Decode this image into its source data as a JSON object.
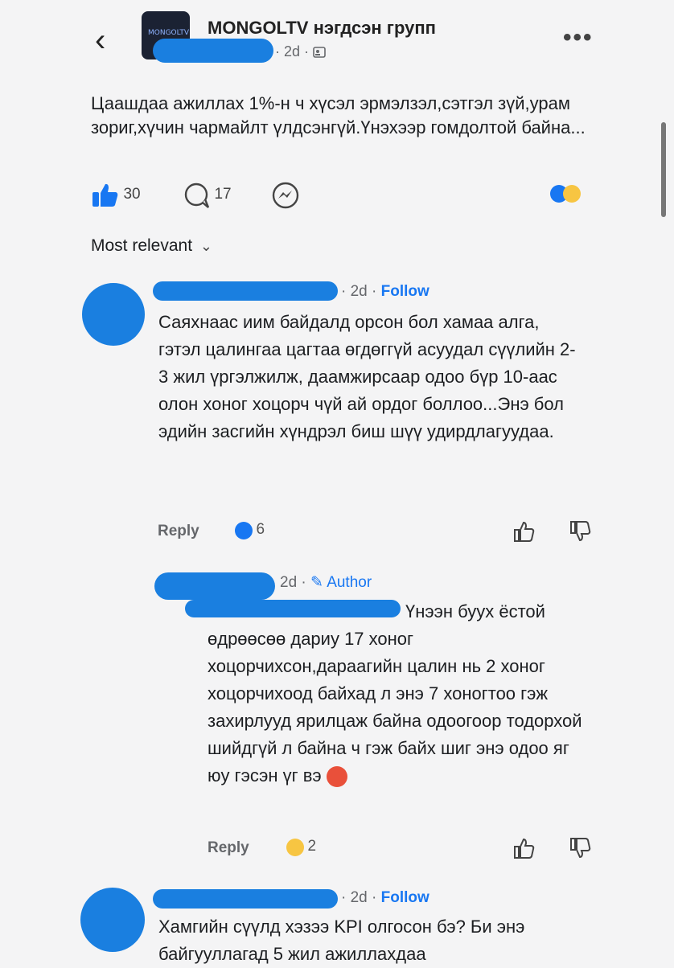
{
  "header": {
    "group_title": "MONGOLTV нэгдсэн групп",
    "post_meta": "· 2d ·",
    "thumb_label": "MONGOLTV",
    "more": "•••"
  },
  "post": {
    "text": "Цаашдаа ажиллах 1%-н ч хүсэл эрмэлзэл,сэтгэл зүй,урам зориг,хүчин чармайлт үлдсэнгүй.Үнэхээр гомдолтой байна...",
    "likes": "30",
    "comments": "17"
  },
  "sort": {
    "label": "Most relevant",
    "chevron": "⌄"
  },
  "comments": [
    {
      "meta": "· 2d ·",
      "follow": "Follow",
      "text": "Саяхнаас иим байдалд орсон бол хамаа алга, гэтэл цалингаа цагтаа өгдөггүй асуудал сүүлийн 2-3 жил үргэлжилж, даамжирсаар одоо бүр 10-аас олон хоног хоцорч чүй ай ордог боллоо...Энэ бол эдийн засгийн хүндрэл биш шүү удирдлагуудаа.",
      "reply": "Reply",
      "reaction_count": "6"
    },
    {
      "meta": "2d ·",
      "author": "Author",
      "text_first": "Үнээн буух ёстой",
      "text": "өдрөөсөө дариу 17 хоног хоцорчихсон,дараагийн цалин нь 2 хоног хоцорчихоод байхад л энэ 7 хоногтоо гэж захирлууд ярилцаж байна одоогоор тодорхой шийдгүй л байна ч гэж байх шиг энэ одоо яг юу гэсэн үг вэ",
      "reply": "Reply",
      "reaction_count": "2"
    },
    {
      "meta": "· 2d ·",
      "follow": "Follow",
      "text": "Хамгийн сүүлд хэзээ KPI олгосон бэ? Би энэ байгууллагад 5 жил ажиллахдаа"
    }
  ],
  "colors": {
    "accent": "#1877f2",
    "redaction": "#1a7fe0"
  }
}
